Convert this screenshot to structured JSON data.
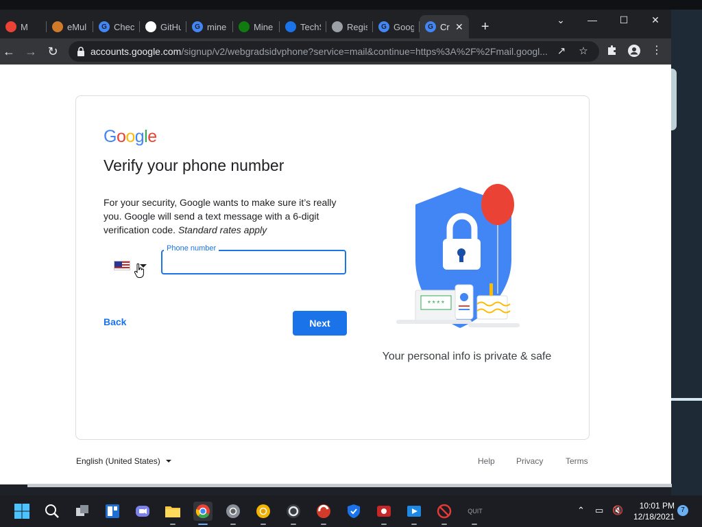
{
  "browser": {
    "tabs": [
      {
        "label": "M",
        "favicon": "red-gmail-favicon",
        "color": "#ea4335"
      },
      {
        "label": "eMul",
        "favicon": "emule-favicon",
        "color": "#d17a2a"
      },
      {
        "label": "Check",
        "favicon": "google-favicon",
        "color": "#4285f4"
      },
      {
        "label": "GitHu",
        "favicon": "github-favicon",
        "color": "#ffffff"
      },
      {
        "label": "mine",
        "favicon": "google-favicon",
        "color": "#4285f4"
      },
      {
        "label": "Mine",
        "favicon": "xbox-favicon",
        "color": "#107c10"
      },
      {
        "label": "TechS",
        "favicon": "techsmith-favicon",
        "color": "#1a73e8"
      },
      {
        "label": "Regis",
        "favicon": "epic-favicon",
        "color": "#9aa0a6"
      },
      {
        "label": "Goog",
        "favicon": "google-favicon",
        "color": "#4285f4"
      },
      {
        "label": "Cr",
        "favicon": "google-favicon",
        "color": "#4285f4"
      }
    ],
    "url_host": "accounts.google.com",
    "url_path": "/signup/v2/webgradsidvphone?service=mail&continue=https%3A%2F%2Fmail.googl..."
  },
  "page": {
    "title": "Verify your phone number",
    "desc_main": "For your security, Google wants to make sure it’s really you. Google will send a text message with a 6-digit verification code. ",
    "desc_italic": "Standard rates apply",
    "phone_label": "Phone number",
    "phone_value": "",
    "back_label": "Back",
    "next_label": "Next",
    "privacy_text": "Your personal info is private & safe",
    "password_mask": "****"
  },
  "footer": {
    "language": "English (United States)",
    "help": "Help",
    "privacy": "Privacy",
    "terms": "Terms"
  },
  "taskbar": {
    "time": "10:01 PM",
    "date": "12/18/2021",
    "notification_count": "7",
    "quit_label": "QUIT"
  },
  "colors": {
    "accent": "#1a73e8",
    "shield": "#4285f4",
    "balloon": "#ea4335"
  }
}
